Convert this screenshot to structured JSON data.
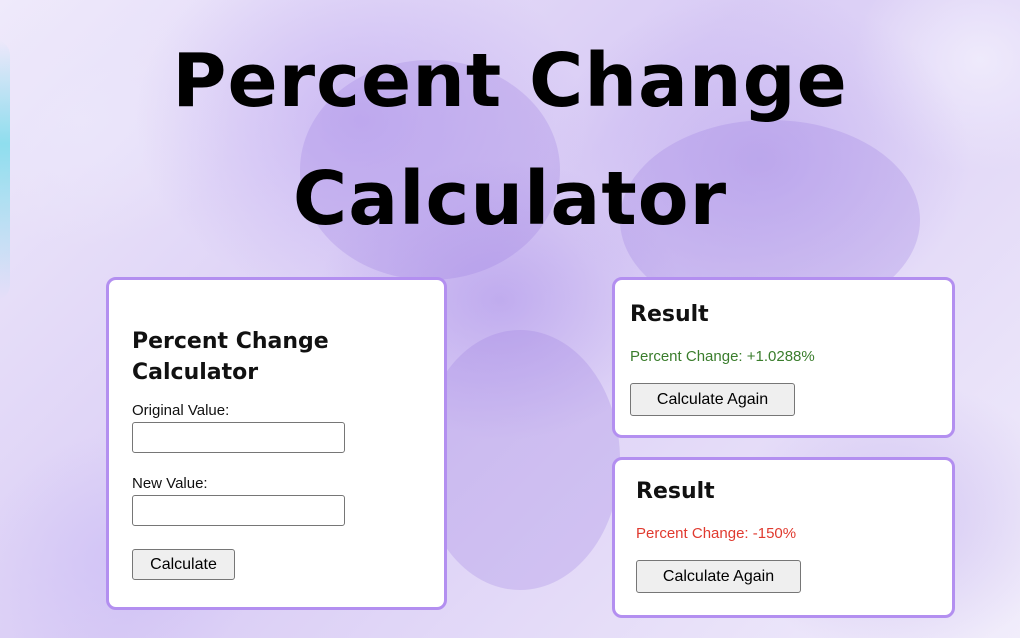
{
  "page": {
    "title": "Percent Change Calculator"
  },
  "calculator": {
    "heading": "Percent Change Calculator",
    "original_label": "Original Value:",
    "original_value": "",
    "new_label": "New Value:",
    "new_value": "",
    "calculate_label": "Calculate"
  },
  "results": [
    {
      "heading": "Result",
      "text": "Percent Change: +1.0288%",
      "color": "#3a7d2c",
      "button_label": "Calculate Again"
    },
    {
      "heading": "Result",
      "text": "Percent Change: -150%",
      "color": "#e03a2f",
      "button_label": "Calculate Again"
    }
  ],
  "colors": {
    "card_border": "#b38ff0",
    "background_accent": "#c9b6f2"
  }
}
